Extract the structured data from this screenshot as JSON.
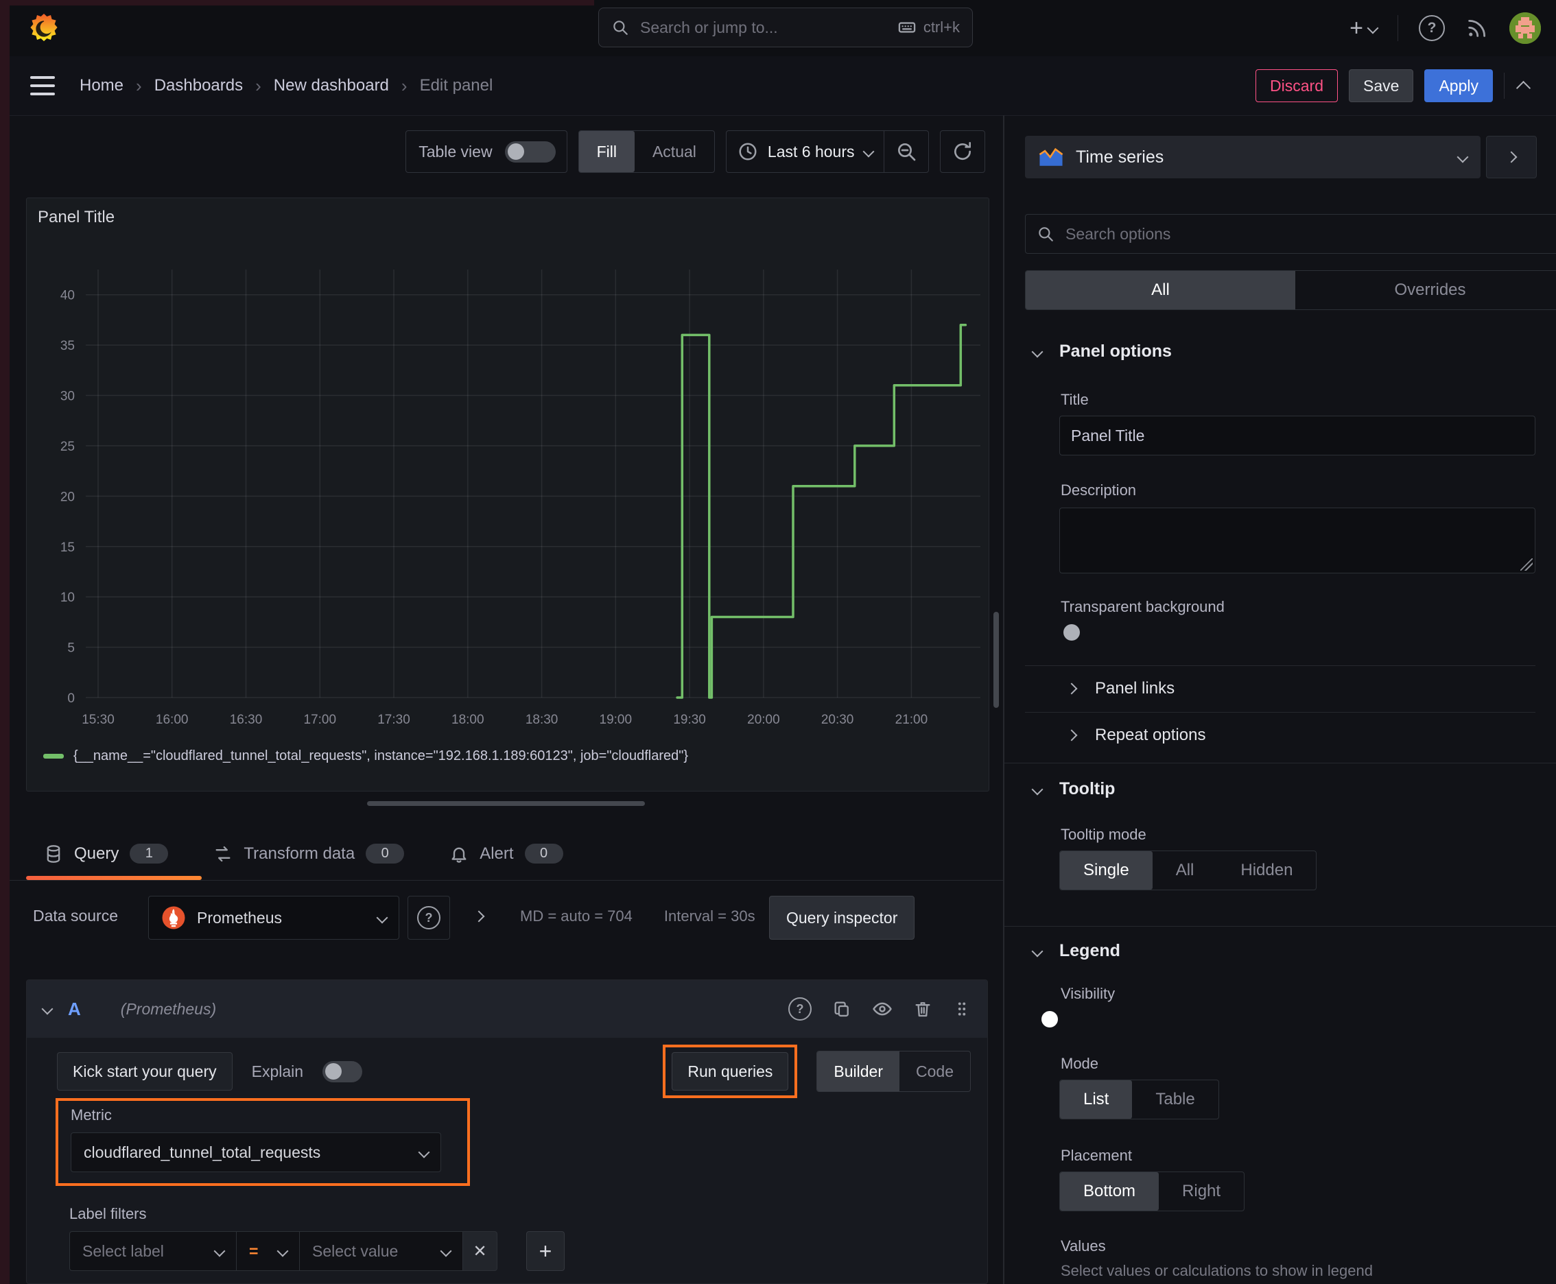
{
  "topbar": {
    "search_placeholder": "Search or jump to...",
    "search_shortcut": "ctrl+k"
  },
  "breadcrumb": {
    "items": [
      "Home",
      "Dashboards",
      "New dashboard",
      "Edit panel"
    ],
    "separator": "›"
  },
  "actions": {
    "discard": "Discard",
    "save": "Save",
    "apply": "Apply"
  },
  "toolbar": {
    "table_view": "Table view",
    "fill": "Fill",
    "actual": "Actual",
    "time_range": "Last 6 hours"
  },
  "panel": {
    "title": "Panel Title"
  },
  "chart_data": {
    "type": "line",
    "title": "Panel Title",
    "line_style": "step-after",
    "grid": true,
    "legend_position": "bottom",
    "x_ticks": [
      "15:30",
      "16:00",
      "16:30",
      "17:00",
      "17:30",
      "18:00",
      "18:30",
      "19:00",
      "19:30",
      "20:00",
      "20:30",
      "21:00"
    ],
    "x_range": [
      "15:25",
      "21:28"
    ],
    "y_ticks": [
      0,
      5,
      10,
      15,
      20,
      25,
      30,
      35,
      40
    ],
    "y_range": [
      0,
      42.5
    ],
    "series": [
      {
        "name": "{__name__=\"cloudflared_tunnel_total_requests\", instance=\"192.168.1.189:60123\", job=\"cloudflared\"}",
        "color": "#73bf69",
        "points": [
          [
            "19:25",
            0
          ],
          [
            "19:27",
            36
          ],
          [
            "19:38",
            0
          ],
          [
            "19:39",
            8
          ],
          [
            "20:12",
            21
          ],
          [
            "20:37",
            25
          ],
          [
            "20:53",
            31
          ],
          [
            "21:20",
            37
          ],
          [
            "21:22",
            37
          ]
        ]
      }
    ]
  },
  "tabs": {
    "query": "Query",
    "query_count": "1",
    "transform": "Transform data",
    "transform_count": "0",
    "alert": "Alert",
    "alert_count": "0"
  },
  "query": {
    "data_source_label": "Data source",
    "data_source_value": "Prometheus",
    "stats_md": "MD = auto = 704",
    "stats_interval": "Interval = 30s",
    "inspector": "Query inspector",
    "row_ref": "A",
    "row_ds": "(Prometheus)",
    "kick_start": "Kick start your query",
    "explain": "Explain",
    "run_queries": "Run queries",
    "builder": "Builder",
    "code": "Code",
    "metric_label": "Metric",
    "metric_value": "cloudflared_tunnel_total_requests",
    "label_filters": "Label filters",
    "select_label": "Select label",
    "operator": "=",
    "select_value": "Select value"
  },
  "options": {
    "viz_type": "Time series",
    "search_placeholder": "Search options",
    "tab_all": "All",
    "tab_overrides": "Overrides",
    "panel_options": "Panel options",
    "title_label": "Title",
    "title_value": "Panel Title",
    "description_label": "Description",
    "transparent_bg": "Transparent background",
    "panel_links": "Panel links",
    "repeat_options": "Repeat options",
    "tooltip": "Tooltip",
    "tooltip_mode": "Tooltip mode",
    "tooltip_single": "Single",
    "tooltip_all": "All",
    "tooltip_hidden": "Hidden",
    "legend": "Legend",
    "visibility": "Visibility",
    "mode": "Mode",
    "mode_list": "List",
    "mode_table": "Table",
    "placement": "Placement",
    "placement_bottom": "Bottom",
    "placement_right": "Right",
    "values": "Values",
    "values_hint": "Select values or calculations to show in legend"
  },
  "icons": {
    "help_glyph": "?",
    "plus_glyph": "+",
    "remove_glyph": "✕"
  },
  "colors": {
    "series_green": "#73bf69",
    "primary_blue": "#3d71d9",
    "danger_pink": "#ff5286",
    "annotation_orange": "#ff6f1f",
    "tab_underline_from": "#f55f3e",
    "tab_underline_to": "#ff8833"
  }
}
